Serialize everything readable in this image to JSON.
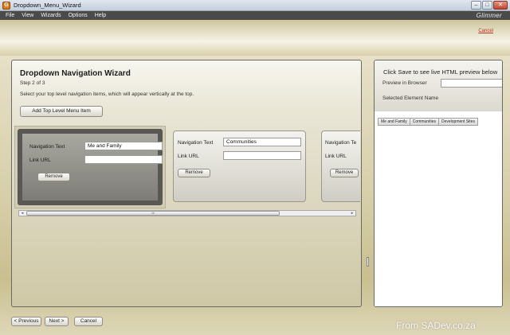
{
  "window": {
    "title": "Dropdown_Menu_Wizard",
    "icon_letter": "G",
    "minimize": "–",
    "maximize": "□",
    "close": "✕"
  },
  "menu": {
    "items": [
      "File",
      "View",
      "Wizards",
      "Options",
      "Help"
    ],
    "brand": "Glimmer"
  },
  "header": {
    "cancel_link": "Cancel"
  },
  "wizard": {
    "title": "Dropdown Navigation Wizard",
    "step": "Step 2 of 3",
    "description": "Select your top level navigation items, which will appear vertically at the top.",
    "add_button": "Add Top Level Menu Item",
    "nav_text_label": "Navigation Text",
    "link_url_label": "Link URL",
    "remove_label": "Remove",
    "third_label_partial": "Navigation Te",
    "third_link_label": "Link URL",
    "items": [
      {
        "nav_text": "Me and Family",
        "link_url": ""
      },
      {
        "nav_text": "Communities",
        "link_url": ""
      }
    ],
    "scroll_grip": "III",
    "scroll_left": "◂",
    "scroll_right": "▸"
  },
  "preview": {
    "title": "Click Save to see live HTML preview below",
    "browser_label": "Preview in Browser",
    "browser_value": "",
    "selected_label": "Selected Element Name",
    "tabs": [
      "Me and Family",
      "Communities",
      "Development Sites"
    ]
  },
  "footer": {
    "previous": "< Previous",
    "next": "Next >",
    "cancel": "Cancel"
  },
  "watermark": "From SADev.co.za"
}
